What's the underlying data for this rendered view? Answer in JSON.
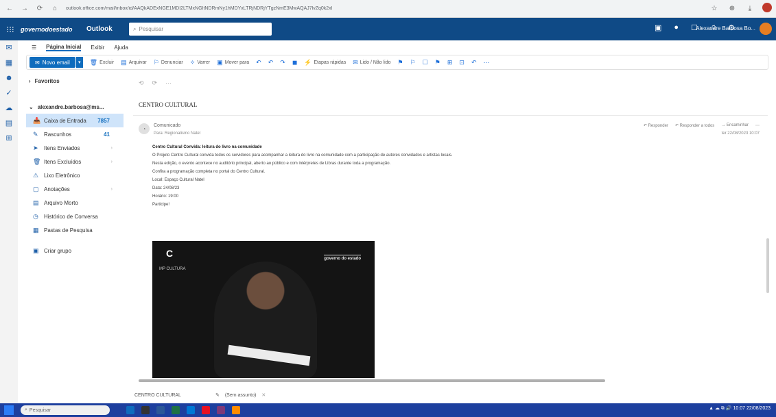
{
  "browser": {
    "url": "outlook.office.com/mail/inbox/id/AAQkADExNGE1MDI2LTMxNGItNDRmNy1hMDYxLTRjNDRjYTgzNmE3MwAQAJ7lvZq0k2xI",
    "nav": [
      "←",
      "→",
      "⟳",
      "⌂"
    ],
    "right_icons": [
      "☆",
      "⊕",
      "⤓"
    ]
  },
  "topbar": {
    "brand": "governodoestado",
    "app_name": "Outlook",
    "search_placeholder": "Pesquisar",
    "user_name": "Alexandre Barbosa Bo...",
    "icons": [
      "⬚",
      "●",
      "⬚",
      "⬚",
      "⚙"
    ]
  },
  "rail": [
    "✉",
    "▦",
    "👥",
    "✓",
    "☁",
    "▤",
    "⊞"
  ],
  "ribbon_tabs": [
    {
      "label": "Página Inicial",
      "active": true
    },
    {
      "label": "Exibir",
      "active": false
    },
    {
      "label": "Ajuda",
      "active": false
    }
  ],
  "ribbon": {
    "new_mail": "Novo email",
    "items": [
      {
        "icon": "🗑",
        "label": "Excluir"
      },
      {
        "icon": "▤",
        "label": "Arquivar"
      },
      {
        "icon": "⚐",
        "label": "Denunciar"
      },
      {
        "icon": "✧",
        "label": "Varrer"
      },
      {
        "icon": "▣",
        "label": "Mover para"
      },
      {
        "icon": "↶",
        "label": ""
      },
      {
        "icon": "↶",
        "label": ""
      },
      {
        "icon": "↷",
        "label": ""
      },
      {
        "icon": "◼",
        "label": ""
      },
      {
        "icon": "⚡",
        "label": "Etapas rápidas"
      },
      {
        "icon": "✉",
        "label": "Lido / Não lido"
      },
      {
        "icon": "⚑",
        "label": ""
      },
      {
        "icon": "⚐",
        "label": ""
      },
      {
        "icon": "☐",
        "label": ""
      },
      {
        "icon": "⚑",
        "label": ""
      },
      {
        "icon": "⊞",
        "label": ""
      },
      {
        "icon": "⊡",
        "label": ""
      },
      {
        "icon": "↶",
        "label": ""
      },
      {
        "icon": "⋯",
        "label": ""
      }
    ]
  },
  "folders": {
    "favorites": "Favoritos",
    "account": "alexandre.barbosa@ms...",
    "items": [
      {
        "icon": "📥",
        "label": "Caixa de Entrada",
        "count": "7857",
        "selected": true
      },
      {
        "icon": "✎",
        "label": "Rascunhos",
        "count": "41",
        "selected": false
      },
      {
        "icon": "➤",
        "label": "Itens Enviados",
        "count": "",
        "selected": false
      },
      {
        "icon": "🗑",
        "label": "Itens Excluídos",
        "count": "",
        "selected": false
      },
      {
        "icon": "⚠",
        "label": "Lixo Eletrônico",
        "count": "",
        "selected": false
      },
      {
        "icon": "▢",
        "label": "Anotações",
        "count": "",
        "selected": false
      },
      {
        "icon": "▤",
        "label": "Arquivo Morto",
        "count": "",
        "selected": false
      },
      {
        "icon": "◷",
        "label": "Histórico de Conversa",
        "count": "",
        "selected": false
      },
      {
        "icon": "▦",
        "label": "Pastas de Pesquisa",
        "count": "",
        "selected": false
      },
      {
        "icon": "▣",
        "label": "Grupos",
        "count": "",
        "selected": false
      }
    ],
    "add_group": "Criar grupo"
  },
  "reading": {
    "breadcrumb": [
      "⟲",
      "⟳",
      "⋯"
    ],
    "subject": "CENTRO CULTURAL",
    "sender": "Comunicado",
    "recipient": "Para: Regionalismo Natel",
    "date": "ter 22/08/2023 10:07",
    "actions": [
      "↶ Responder",
      "↶ Responder a todos",
      "→ Encaminhar",
      "⋯"
    ],
    "body_lead": "Centro Cultural Convida: leitura do livro na comunidade",
    "body_paras": [
      "O Projeto Centro Cultural convida todos os servidores para acompanhar a leitura do livro na comunidade com a participação de autores convidados e artistas locais.",
      "Nesta edição, o evento acontece no auditório principal, aberto ao público e com intérpretes de Libras durante toda a programação.",
      "Confira a programação completa no portal do Centro Cultural."
    ],
    "location": "Local: Espaço Cultural Natel",
    "date_label": "Data: 24/08/23",
    "time_label": "Horário: 19:00",
    "closing": "Participe!"
  },
  "poster": {
    "left_logo": "C",
    "left_text": "MP CULTURA",
    "right_logo": "governo do estado"
  },
  "bottom_tabs": {
    "tab1": "CENTRO CULTURAL",
    "draft": "(Sem assunto)",
    "close": "✕"
  },
  "taskbar": {
    "search": "Pesquisar",
    "apps": [
      "#0f6cbd",
      "#333333",
      "#2b5797",
      "#1e7145",
      "#0078d4",
      "#e81123",
      "#7e3878",
      "#ff8c00"
    ],
    "tray": "▲ ☁ ⧉ 🔊 10:07 22/08/2023"
  }
}
